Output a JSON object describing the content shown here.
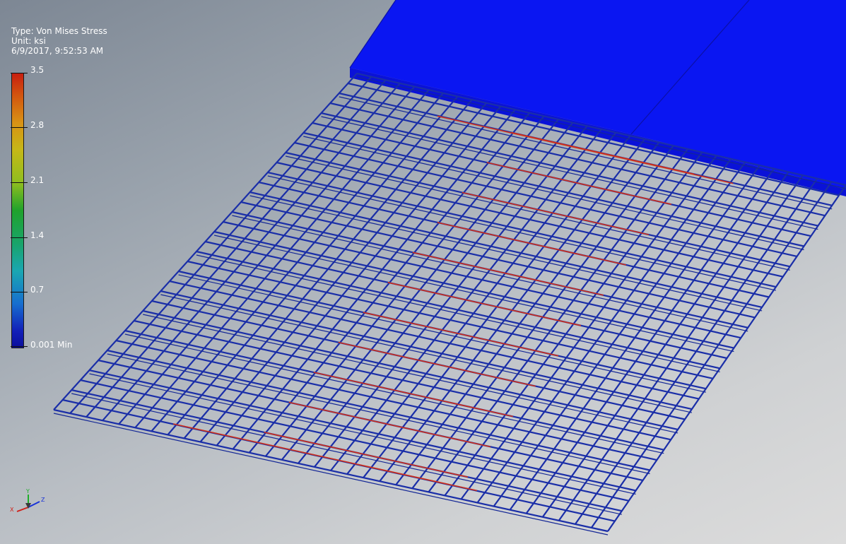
{
  "legend": {
    "type_line": "Type: Von Mises Stress",
    "unit_line": "Unit: ksi",
    "date_line": "6/9/2017, 9:52:53 AM",
    "ticks": [
      "3.5",
      "2.8",
      "2.1",
      "1.4",
      "0.7",
      "0.001 Min"
    ],
    "colors": [
      "#c81e0f",
      "#d99215",
      "#1fa22c",
      "#1aa7b1",
      "#121fb8"
    ]
  },
  "triad": {
    "x_label": "X",
    "y_label": "Y",
    "z_label": "Z"
  },
  "model": {
    "block_color": "#0a14f5",
    "mesh_color": "#1a2ea8",
    "hot_color": "#d0301a"
  }
}
